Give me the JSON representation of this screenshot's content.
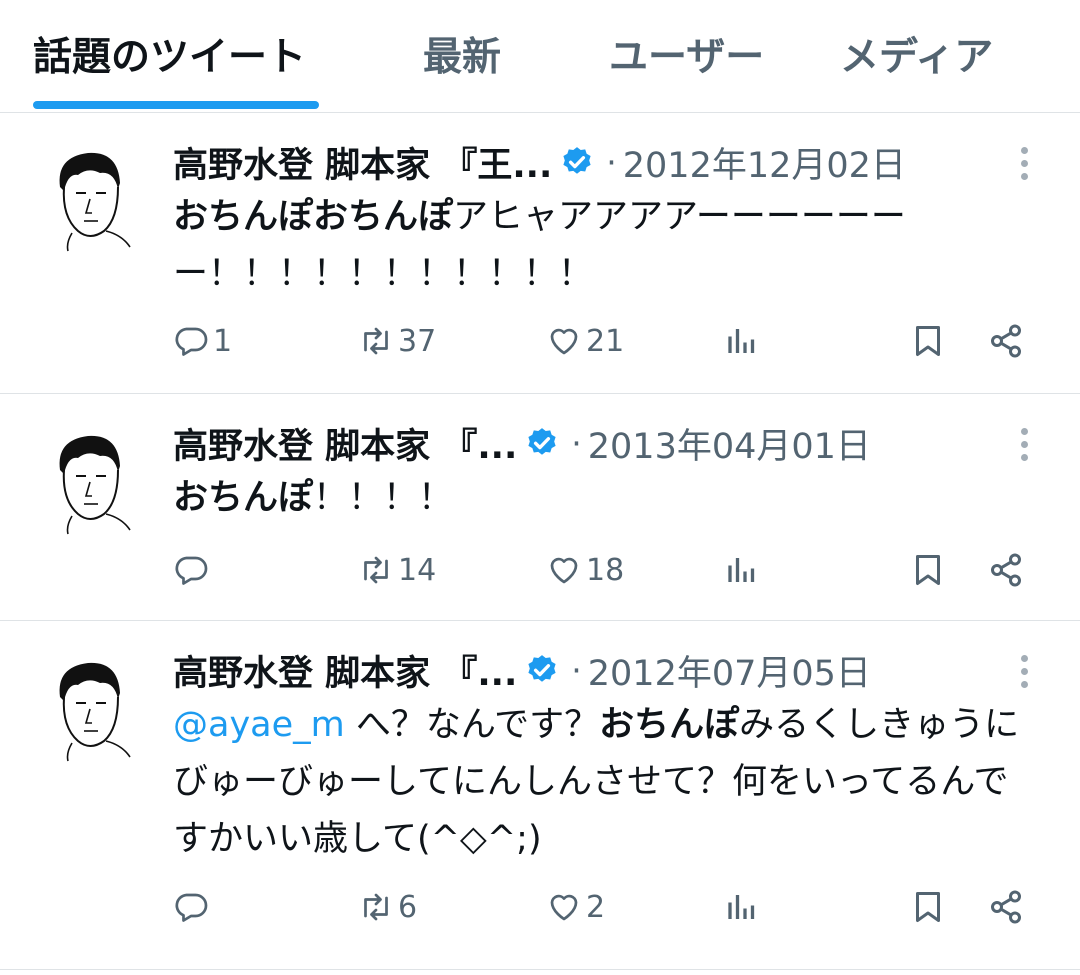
{
  "tabs": [
    {
      "label": "話題のツイート",
      "active": true
    },
    {
      "label": "最新",
      "active": false
    },
    {
      "label": "ユーザー",
      "active": false
    },
    {
      "label": "メディア",
      "active": false
    }
  ],
  "colors": {
    "accent": "#1d9bf0",
    "muted": "#536471",
    "text": "#0f1419",
    "divider": "#dfe3e6"
  },
  "tweets": [
    {
      "name": "高野水登 脚本家 『王...",
      "sep": "·",
      "date": "2012年12月02日",
      "body": {
        "bold": "おちんぽおちんぽ",
        "rest": "アヒャアアアアーーーーーーー！！！！！！！！！！！"
      },
      "counts": {
        "reply": "1",
        "retweet": "37",
        "like": "21"
      }
    },
    {
      "name": "高野水登 脚本家 『...",
      "sep": "·",
      "date": "2013年04月01日",
      "body": {
        "bold": "おちんぽ",
        "rest": "！！！！"
      },
      "counts": {
        "reply": "",
        "retweet": "14",
        "like": "18"
      }
    },
    {
      "name": "高野水登 脚本家 『...",
      "sep": "·",
      "date": "2012年07月05日",
      "body": {
        "mention": "@ayae_m",
        "pre": " へ？なんです？",
        "bold": "おちんぽ",
        "rest": "みるくしきゅうにびゅーびゅーしてにんしんさせて？何をいってるんですかいい歳して(^◇^;)"
      },
      "counts": {
        "reply": "",
        "retweet": "6",
        "like": "2"
      }
    }
  ],
  "icons": [
    "reply-icon",
    "retweet-icon",
    "like-icon",
    "views-icon",
    "bookmark-icon",
    "share-icon",
    "verified-badge-icon",
    "more-icon"
  ]
}
